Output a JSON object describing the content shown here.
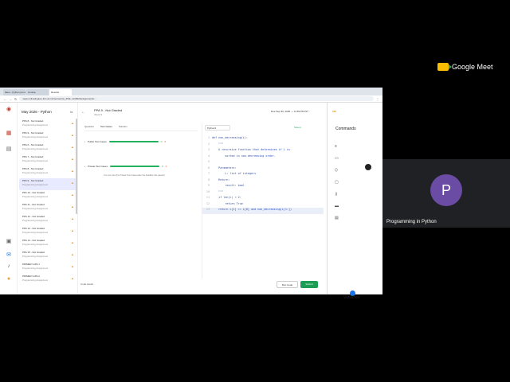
{
  "meet": {
    "logo_text": "Google Meet",
    "participant_initial": "P",
    "participant_name": "Programming in Python"
  },
  "browser": {
    "tabs": [
      "Meet - Python pro Exam",
      "Course",
      "Results"
    ],
    "url": "seek.onlinedegree.iitm.ac.in/courses/ns_25t2_cs1002/assignments/..."
  },
  "sidebar": {
    "course_title": "May 2026 - Python",
    "items": [
      {
        "title": "PPA 8 - Not Graded",
        "sub": "Programming Assignment"
      },
      {
        "title": "PPA 9 - Not Graded",
        "sub": "Programming Assignment"
      },
      {
        "title": "PPA 6 - Not Graded",
        "sub": "Programming Assignment"
      },
      {
        "title": "PPA 7 - Not Graded",
        "sub": "Programming Assignment"
      },
      {
        "title": "PPA 8 - Not Graded",
        "sub": "Programming Assignment"
      },
      {
        "title": "PPA 9 - Not Graded",
        "sub": "Programming Assignment"
      },
      {
        "title": "PPA 10 - Not Graded",
        "sub": "Programming Assignment"
      },
      {
        "title": "PPA 11 - Not Graded",
        "sub": "Programming Assignment"
      },
      {
        "title": "PPA 12 - Not Graded",
        "sub": "Programming Assignment"
      },
      {
        "title": "PPA 13 - Not Graded",
        "sub": "Programming Assignment"
      },
      {
        "title": "PPA 14 - Not Graded",
        "sub": "Programming Assignment"
      },
      {
        "title": "PPA 15 - Not Graded",
        "sub": "Programming Assignment"
      },
      {
        "title": "PRIMER GrPA 1",
        "sub": "Programming Assignment"
      },
      {
        "title": "PRIMER GrPA 2",
        "sub": "Programming Assignment"
      }
    ]
  },
  "header": {
    "title": "PPA 9 - Not Graded",
    "subtitle": "Week 9",
    "due": "Due Sep 30, 2026 — 11:59 PM IST"
  },
  "tabs": [
    "Question",
    "Test Cases",
    "Solution"
  ],
  "tests": [
    {
      "label": "Public Test Cases",
      "pass": "0",
      "fail": "0"
    },
    {
      "label": "Private Test Cases",
      "pass": "0",
      "fail": "0"
    }
  ],
  "hidden_note": "You can view the Private Test Cases after the deadline has passed",
  "editor": {
    "language": "Python3",
    "saved": "Saved",
    "lines": [
      "def non_decreasing(L):",
      "    \"\"\"",
      "    A recursive function that determines if L is",
      "        sorted in non-decreasing order.",
      "",
      "    Parameters:",
      "        L: list of integers",
      "    Return:",
      "        result: bool",
      "    \"\"\"",
      "    if len(L) < 2:",
      "        return True",
      "    return L[1] >= L[0] and non_decreasing(L[1:])"
    ]
  },
  "footer": {
    "code_assist": "Code Assist",
    "run": "Run Code",
    "submit": "Submit"
  },
  "rpanel": {
    "commands": "Commands",
    "variables": "Variables"
  }
}
